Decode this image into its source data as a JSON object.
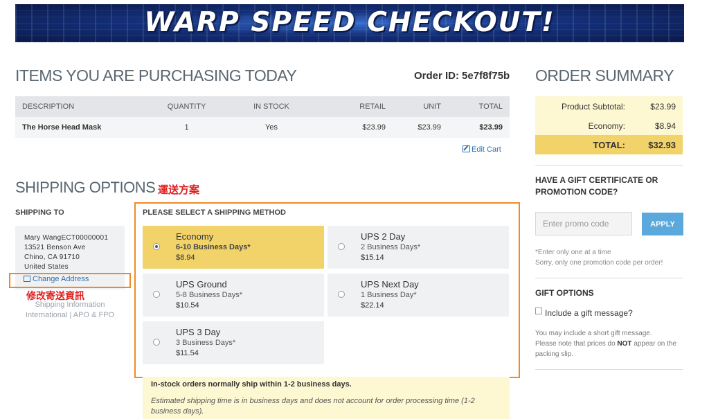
{
  "banner": {
    "title": "WARP SPEED CHECKOUT!"
  },
  "items": {
    "heading": "ITEMS YOU ARE PURCHASING TODAY",
    "order_id_label": "Order ID:",
    "order_id": "5e7f8f75b",
    "columns": [
      "DESCRIPTION",
      "QUANTITY",
      "IN STOCK",
      "RETAIL",
      "UNIT",
      "TOTAL"
    ],
    "rows": [
      {
        "description": "The Horse Head Mask",
        "quantity": "1",
        "in_stock": "Yes",
        "retail": "$23.99",
        "unit": "$23.99",
        "total": "$23.99"
      }
    ],
    "edit_cart": "Edit Cart"
  },
  "shipping": {
    "heading": "SHIPPING OPTIONS",
    "annotation": "運送方案",
    "ship_to_label": "SHIPPING TO",
    "address_lines": [
      "Mary WangECT00000001",
      "13521 Benson Ave",
      "Chino, CA 91710",
      "United States"
    ],
    "change_address": "Change Address",
    "address_annotation": "修改寄送資訊",
    "info_link": "Shipping Information",
    "info_link2": "International | APO & FPO",
    "method_label": "PLEASE SELECT A SHIPPING METHOD",
    "options": [
      {
        "name": "Economy",
        "days": "6-10 Business Days*",
        "price": "$8.94",
        "selected": true
      },
      {
        "name": "UPS 2 Day",
        "days": "2 Business Days*",
        "price": "$15.14",
        "selected": false
      },
      {
        "name": "UPS Ground",
        "days": "5-8 Business Days*",
        "price": "$10.54",
        "selected": false
      },
      {
        "name": "UPS Next Day",
        "days": "1 Business Day*",
        "price": "$22.14",
        "selected": false
      },
      {
        "name": "UPS 3 Day",
        "days": "3 Business Days*",
        "price": "$11.54",
        "selected": false
      }
    ],
    "note1": "In-stock orders normally ship within 1-2 business days.",
    "note2": "Estimated shipping time is in business days and does not account for order processing time (1-2 business days)."
  },
  "summary": {
    "heading": "ORDER SUMMARY",
    "subtotal_label": "Product Subtotal:",
    "subtotal": "$23.99",
    "shipping_label": "Economy:",
    "shipping": "$8.94",
    "total_label": "TOTAL:",
    "total": "$32.93",
    "promo_heading_1": "HAVE A GIFT CERTIFICATE OR",
    "promo_heading_2": "PROMOTION CODE?",
    "promo_placeholder": "Enter promo code",
    "apply_label": "APPLY",
    "promo_note_1": "*Enter only one at a time",
    "promo_note_2": "Sorry, only one promotion code per order!",
    "gift_heading": "GIFT OPTIONS",
    "gift_check_label": "Include a gift message?",
    "gift_note_1": "You may include a short gift message.",
    "gift_note_2a": "Please note that prices do",
    "gift_note_2b": "NOT",
    "gift_note_2c": "appear on the packing slip."
  },
  "colors": {
    "banner_blue": "#14307a",
    "selected_option": "#f2d36a",
    "summary_bg": "#fdf7d2",
    "link_blue": "#2a6fb5",
    "apply_blue": "#5aa8dc",
    "annotation_orange": "#f08a24",
    "annotation_red": "#e02020"
  }
}
